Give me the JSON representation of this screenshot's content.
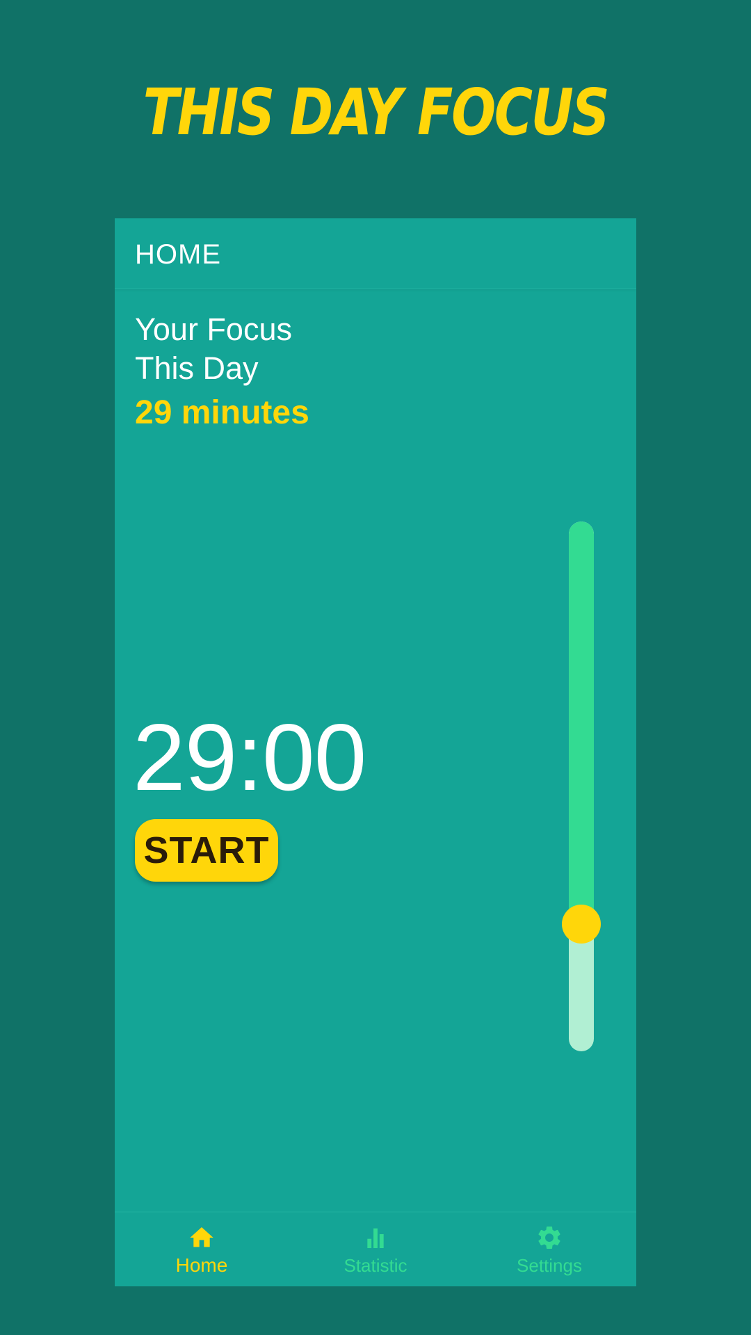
{
  "promo": {
    "title": "THIS DAY FOCUS"
  },
  "app_bar": {
    "title": "HOME"
  },
  "focus": {
    "label_line1": "Your Focus",
    "label_line2": "This Day",
    "value": "29 minutes"
  },
  "timer": {
    "display": "29:00",
    "start_label": "START"
  },
  "slider": {
    "level_fraction": 0.76
  },
  "bottom_nav": {
    "items": [
      {
        "label": "Home",
        "icon": "home-icon",
        "active": true
      },
      {
        "label": "Statistic",
        "icon": "bar-chart-icon",
        "active": false
      },
      {
        "label": "Settings",
        "icon": "gear-icon",
        "active": false
      }
    ]
  },
  "colors": {
    "background": "#107267",
    "surface": "#14A596",
    "accent_yellow": "#FFD60A",
    "accent_green": "#33DB92",
    "track_light": "#B1EFD3"
  }
}
